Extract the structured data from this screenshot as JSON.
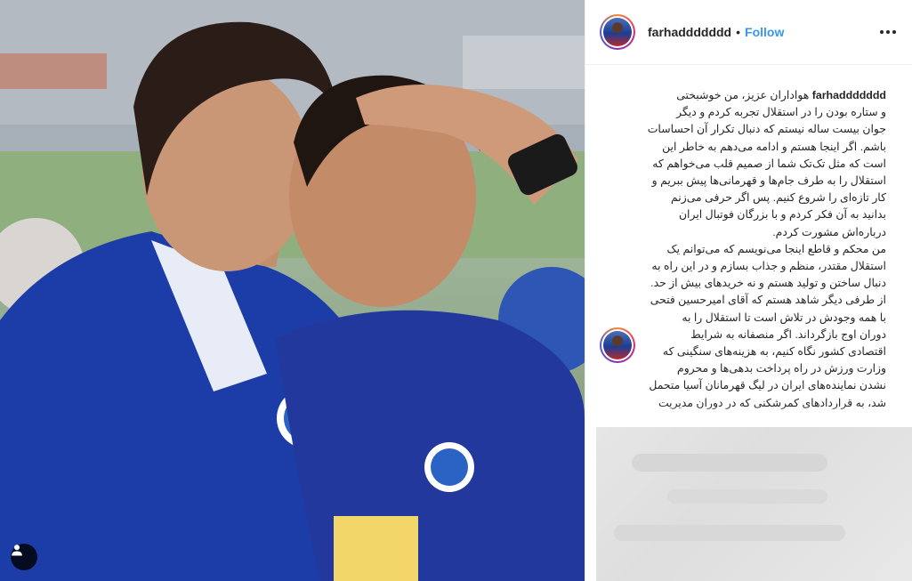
{
  "post": {
    "username": "farhaddddddd",
    "separator": "•",
    "follow_label": "Follow",
    "more_icon": "more-horizontal-icon",
    "user_tag_icon": "user-tag-icon"
  },
  "caption": {
    "username": "farhaddddddd",
    "text": "هواداران عزیز، من خوشبختی \nو ستاره بودن را در استقلال تجربه کردم و دیگر\nجوان بیست ساله نیستم که دنبال تکرار آن احساسات\nباشم. اگر اینجا هستم و ادامه می‌دهم به خاطر این\nاست که مثل تک‌تک شما از صمیم قلب می‌خواهم که\nاستقلال را به طرف جام‌ها و قهرمانی‌ها پیش ببریم و\nکار تازه‌ای را شروع کنیم. پس اگر حرفی می‌زنم\nبدانید به آن فکر کردم و با بزرگان فوتبال ایران\nدرباره‌اش مشورت کردم.\nمن محکم و قاطع اینجا می‌نویسم که می‌توانم یک\nاستقلال مقتدر، منظم و جذاب بسازم و در این راه به\nدنبال ساختن و تولید هستم و نه خریدهای بیش از حد.\nاز طرفی دیگر شاهد هستم که آقای امیرحسین فتحی\nبا همه وجودش در تلاش است تا استقلال را به\nدوران اوج بازگرداند. اگر منصفانه به شرایط\nاقتصادی کشور نگاه کنیم، به هزینه‌های سنگینی که\nوزارت ورزش در راه پرداخت بدهی‌ها و محروم\nنشدن نماینده‌های ایران در لیگ قهرمانان آسیا متحمل\nشد، به قراردادهای کمرشکنی که در دوران مدیریت"
  },
  "colors": {
    "follow": "#3897f0",
    "text": "#262626",
    "border": "#efefef",
    "jersey_blue": "#1c3da8"
  }
}
